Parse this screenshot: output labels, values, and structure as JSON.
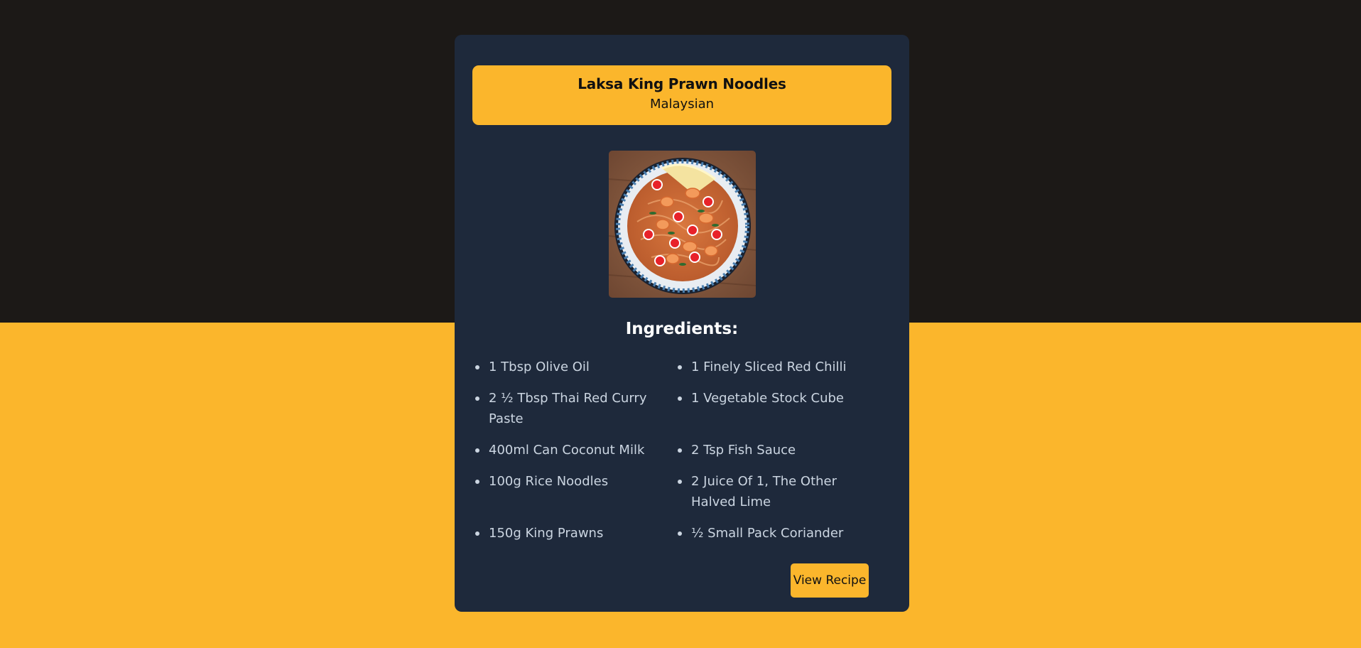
{
  "recipe": {
    "title": "Laksa King Prawn Noodles",
    "cuisine": "Malaysian",
    "photo_icon": "noodle-bowl-photo"
  },
  "ingredients": {
    "heading": "Ingredients:",
    "items": [
      "1 Tbsp Olive Oil",
      "1 Finely Sliced Red Chilli",
      "2 ½ Tbsp Thai Red Curry Paste",
      "1 Vegetable Stock Cube",
      "400ml Can Coconut Milk",
      "2 Tsp Fish Sauce",
      "100g Rice Noodles",
      "2 Juice Of 1, The Other Halved Lime",
      "150g King Prawns",
      "½ Small Pack Coriander"
    ]
  },
  "actions": {
    "view_recipe_label": "View Recipe"
  },
  "colors": {
    "background_top": "#1c1917",
    "accent": "#fbb62c",
    "card": "#1e293b",
    "ingredient_text": "#cbd5e1"
  }
}
